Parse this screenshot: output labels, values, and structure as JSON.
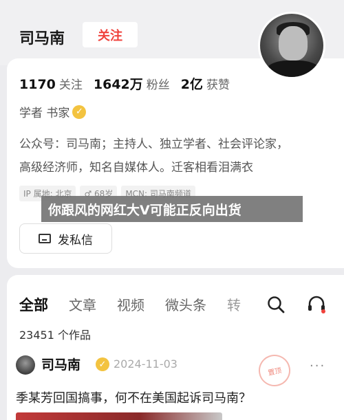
{
  "profile": {
    "name": "司马南",
    "follow_label": "关注",
    "stats": [
      {
        "value": "1170",
        "label": "关注"
      },
      {
        "value": "1642万",
        "label": "粉丝"
      },
      {
        "value": "2亿",
        "label": "获赞"
      }
    ],
    "tags": "学者 书家",
    "bio_line1": "公众号：司马南；主持人、独立学者、社会评论家，",
    "bio_line2": "高级经济师，知名自媒体人。迁客相看泪满衣",
    "ip_location": "IP 属地: 北京",
    "age": "68岁",
    "mcn": "MCN: 司马南频道",
    "dm_label": "发私信",
    "verified_color": "#f3c340",
    "accent_color": "#f0423c"
  },
  "banner": {
    "text": "你跟风的网红大V可能正反向出货"
  },
  "tabs": {
    "items": [
      "全部",
      "文章",
      "视频",
      "微头条",
      "转"
    ]
  },
  "works": {
    "count_label": "23451 个作品"
  },
  "post": {
    "author": "司马南",
    "date": "2024-11-03",
    "stamp_text": "置顶",
    "title": "季某芳回国搞事，何不在美国起诉司马南？",
    "more_icon": "more-dots-icon"
  }
}
